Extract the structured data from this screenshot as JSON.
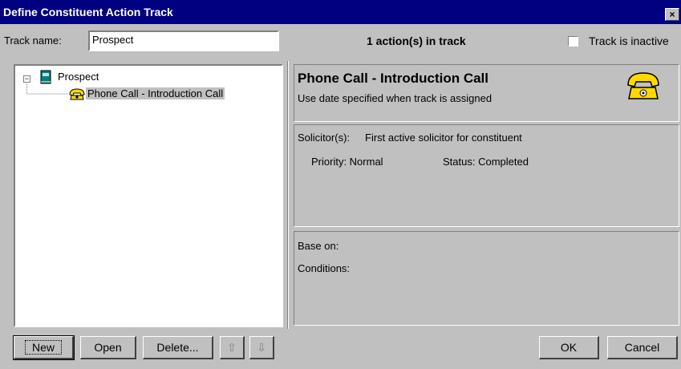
{
  "window": {
    "title": "Define Constituent Action Track",
    "close_glyph": "×"
  },
  "track": {
    "name_label": "Track name:",
    "name_value": "Prospect",
    "actions_count_text": "1 action(s) in track",
    "inactive_label": "Track is inactive",
    "inactive_checked": false
  },
  "tree": {
    "root_label": "Prospect",
    "root_icon": "book-icon",
    "expander_glyph": "−",
    "child_label": "Phone Call - Introduction Call",
    "child_icon": "phone-icon"
  },
  "action": {
    "title": "Phone Call - Introduction Call",
    "date_text": "Use date specified when track is assigned",
    "icon": "phone-icon"
  },
  "details": {
    "solicitor_label": "Solicitor(s):",
    "solicitor_value": "First active solicitor for constituent",
    "priority_text": "Priority: Normal",
    "status_text": "Status: Completed"
  },
  "base": {
    "base_on_label": "Base on:",
    "conditions_label": "Conditions:"
  },
  "buttons": {
    "new": "New",
    "open": "Open",
    "delete": "Delete...",
    "up_glyph": "⇧",
    "down_glyph": "⇩",
    "ok": "OK",
    "cancel": "Cancel"
  },
  "colors": {
    "titlebar": "#000080",
    "face": "#c0c0c0",
    "phone_yellow": "#ffd800"
  }
}
